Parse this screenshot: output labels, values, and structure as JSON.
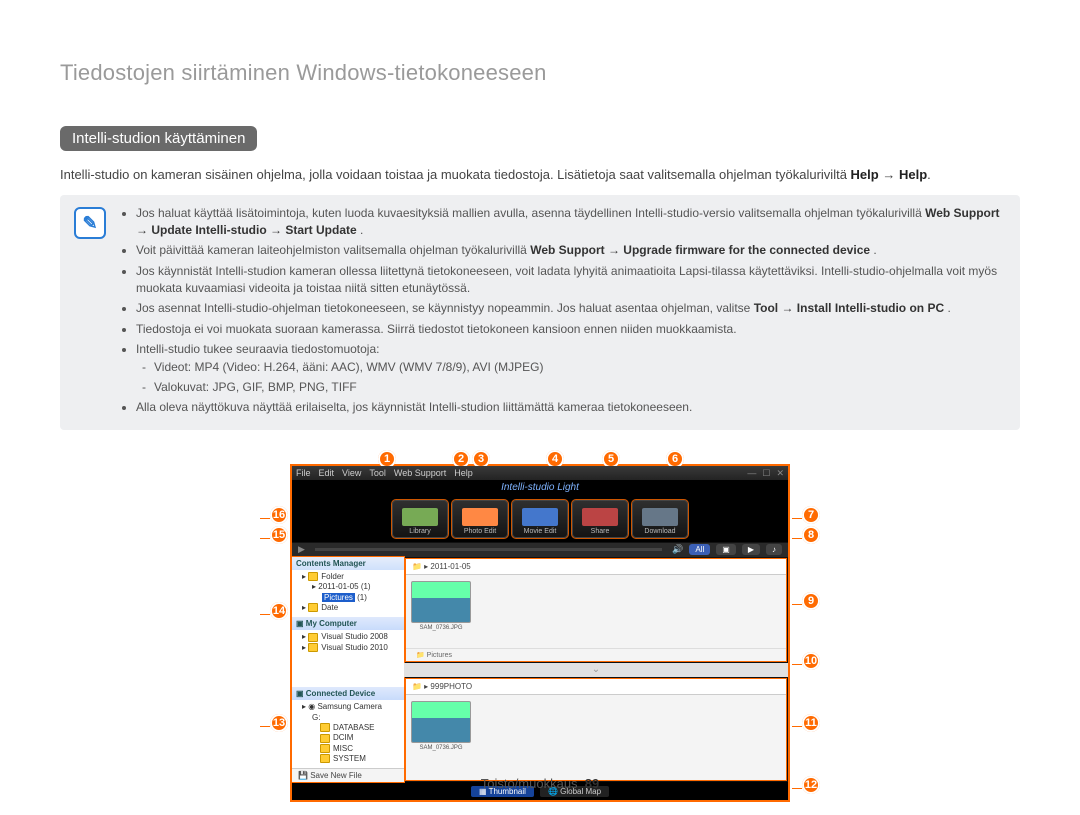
{
  "page": {
    "breadcrumb": "Tiedostojen siirtäminen Windows-tietokoneeseen",
    "section_title": "Intelli-studion käyttäminen",
    "intro_before": "Intelli-studio on kameran sisäinen ohjelma, jolla voidaan toistaa ja muokata tiedostoja. Lisätietoja saat valitsemalla ohjelman työkaluriviltä ",
    "intro_bold1": "Help",
    "intro_arrow": " → ",
    "intro_bold2": "Help",
    "intro_period": "."
  },
  "note": {
    "bullets": [
      {
        "pre": "Jos haluat käyttää lisätoimintoja, kuten luoda kuvaesityksiä mallien avulla, asenna täydellinen Intelli-studio-versio valitsemalla ohjelman työkalurivillä ",
        "bold": "Web Support → Update Intelli-studio → Start Update",
        "post": "."
      },
      {
        "pre": "Voit päivittää kameran laiteohjelmiston valitsemalla ohjelman työkalurivillä ",
        "bold": "Web Support → Upgrade firmware for the connected device",
        "post": "."
      },
      {
        "pre": "Jos käynnistät Intelli-studion kameran ollessa liitettynä tietokoneeseen, voit ladata lyhyitä animaatioita Lapsi-tilassa käytettäviksi. Intelli-studio-ohjelmalla voit myös muokata kuvaamiasi videoita ja toistaa niitä sitten etunäytössä.",
        "bold": "",
        "post": ""
      },
      {
        "pre": "Jos asennat Intelli-studio-ohjelman tietokoneeseen, se käynnistyy nopeammin. Jos haluat asentaa ohjelman, valitse ",
        "bold": "Tool → Install Intelli-studio on PC",
        "post": "."
      },
      {
        "pre": "Tiedostoja ei voi muokata suoraan kamerassa. Siirrä tiedostot tietokoneen kansioon ennen niiden muokkaamista.",
        "bold": "",
        "post": ""
      },
      {
        "pre": "Intelli-studio tukee seuraavia tiedostomuotoja:",
        "bold": "",
        "post": "",
        "sub": [
          "Videot: MP4 (Video: H.264, ääni: AAC), WMV (WMV 7/8/9), AVI (MJPEG)",
          "Valokuvat: JPG, GIF, BMP, PNG, TIFF"
        ]
      },
      {
        "pre": "Alla oleva näyttökuva näyttää erilaiselta, jos käynnistät Intelli-studion liittämättä kameraa tietokoneeseen.",
        "bold": "",
        "post": ""
      }
    ]
  },
  "callouts": {
    "top": [
      "1",
      "2",
      "3",
      "4",
      "5",
      "6"
    ],
    "right": [
      "7",
      "8",
      "9",
      "10",
      "11",
      "12"
    ],
    "left": [
      "16",
      "15",
      "14",
      "13"
    ]
  },
  "app": {
    "menubar": [
      "File",
      "Edit",
      "View",
      "Tool",
      "Web Support",
      "Help"
    ],
    "brand": "Intelli-studio  Light",
    "modes": [
      "Library",
      "Photo Edit",
      "Movie Edit",
      "Share",
      "Download"
    ],
    "playbar_all": "All",
    "sidebar": {
      "contents_manager": "Contents Manager",
      "folder_label": "Folder",
      "folder_date": "2011-01-05",
      "folder_count": "(1)",
      "pictures": "Pictures",
      "pictures_count": "(1)",
      "date_label": "Date",
      "my_computer": "My Computer",
      "vs2008": "Visual Studio 2008",
      "vs2010": "Visual Studio 2010",
      "connected_device": "Connected Device",
      "samsung_camera": "Samsung Camera",
      "drive": "G:",
      "subfolders": [
        "DATABASE",
        "DCIM",
        "MISC",
        "SYSTEM"
      ],
      "save_new_file": "Save New File"
    },
    "content": {
      "crumb_top": "2011-01-05",
      "thumb_label_top": "SAM_0736.JPG",
      "cp_sub": "Pictures",
      "crumb_bottom": "999PHOTO",
      "thumb_label_bottom": "SAM_0736.JPG"
    },
    "bottom_bar": {
      "thumbnail": "Thumbnail",
      "global_map": "Global Map"
    }
  },
  "footer": {
    "label": "Toisto/muokkaus",
    "page_num": "89"
  }
}
